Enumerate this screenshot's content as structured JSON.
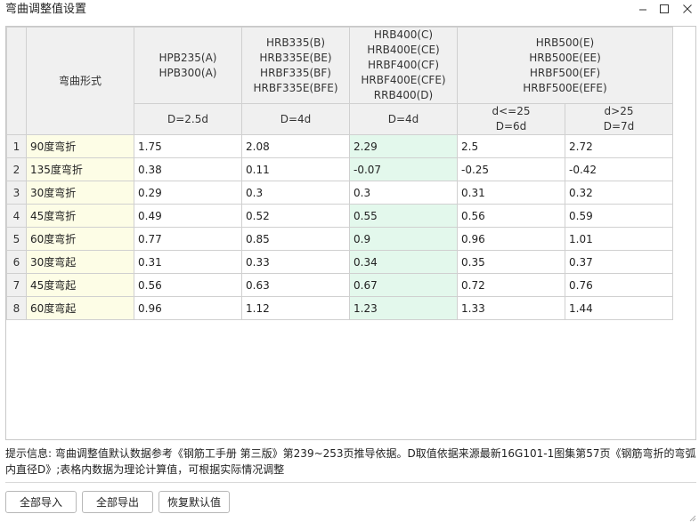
{
  "window": {
    "title": "弯曲调整值设置",
    "minimize_icon": "minimize-icon",
    "maximize_icon": "maximize-icon",
    "close_icon": "close-icon"
  },
  "table": {
    "header": {
      "form_label": "弯曲形式",
      "groups": [
        "HPB235(A)\nHPB300(A)",
        "HRB335(B)\nHRB335E(BE)\nHRBF335(BF)\nHRBF335E(BFE)",
        "HRB400(C)\nHRB400E(CE)\nHRBF400(CF)\nHRBF400E(CFE)\nRRB400(D)",
        "HRB500(E)\nHRB500E(EE)\nHRBF500(EF)\nHRBF500E(EFE)"
      ],
      "diameters": [
        "D=2.5d",
        "D=4d",
        "D=4d",
        "d<=25\nD=6d",
        "d>25\nD=7d"
      ]
    },
    "rows": [
      {
        "num": "1",
        "form": "90度弯折",
        "values": [
          "1.75",
          "2.08",
          "2.29",
          "2.5",
          "2.72"
        ]
      },
      {
        "num": "2",
        "form": "135度弯折",
        "values": [
          "0.38",
          "0.11",
          "-0.07",
          "-0.25",
          "-0.42"
        ]
      },
      {
        "num": "3",
        "form": "30度弯折",
        "values": [
          "0.29",
          "0.3",
          "0.3",
          "0.31",
          "0.32"
        ]
      },
      {
        "num": "4",
        "form": "45度弯折",
        "values": [
          "0.49",
          "0.52",
          "0.55",
          "0.56",
          "0.59"
        ]
      },
      {
        "num": "5",
        "form": "60度弯折",
        "values": [
          "0.77",
          "0.85",
          "0.9",
          "0.96",
          "1.01"
        ]
      },
      {
        "num": "6",
        "form": "30度弯起",
        "values": [
          "0.31",
          "0.33",
          "0.34",
          "0.35",
          "0.37"
        ]
      },
      {
        "num": "7",
        "form": "45度弯起",
        "values": [
          "0.56",
          "0.63",
          "0.67",
          "0.72",
          "0.76"
        ]
      },
      {
        "num": "8",
        "form": "60度弯起",
        "values": [
          "0.96",
          "1.12",
          "1.23",
          "1.33",
          "1.44"
        ]
      }
    ],
    "colors": {
      "form_column": "#fdfde6",
      "highlight_values": "#e3f8ec",
      "header": "#f0f0f0"
    }
  },
  "info": {
    "text": "提示信息: 弯曲调整值默认数据参考《钢筋工手册 第三版》第239~253页推导依据。D取值依据来源最新16G101-1图集第57页《钢筋弯折的弯弧内直径D》;表格内数据为理论计算值，可根据实际情况调整"
  },
  "buttons": {
    "import_all": "全部导入",
    "export_all": "全部导出",
    "restore_default": "恢复默认值"
  }
}
